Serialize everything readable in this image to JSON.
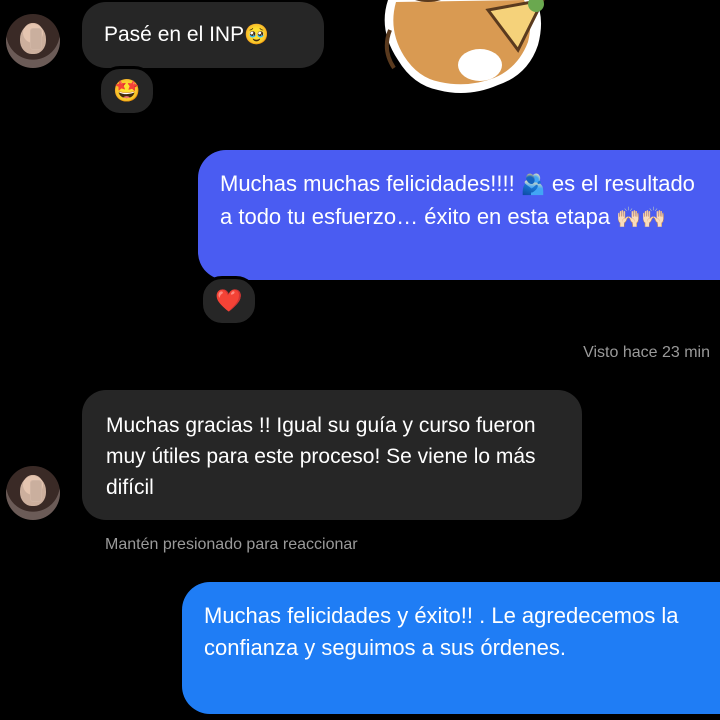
{
  "messages": [
    {
      "text": "Pasé en el INP",
      "emoji": "🥹",
      "reaction": "🤩"
    },
    {
      "text_1": "Muchas muchas felicidades!!!! ",
      "emoji_1": "🫂",
      "text_2": " es el resultado a todo tu esfuerzo… éxito en esta etapa ",
      "emoji_2": "🙌🏻🙌🏻",
      "reaction": "❤️"
    },
    {
      "text": "Muchas gracias !! Igual su guía y curso fueron muy útiles para este proceso! Se viene lo más difícil"
    },
    {
      "text": "Muchas felicidades y éxito!! . Le agredecemos la confianza y seguimos a sus órdenes."
    }
  ],
  "seen_status": "Visto hace 23 min",
  "hold_hint": "Mantén presionado para reaccionar",
  "colors": {
    "incoming": "#262626",
    "outgoing_1": "#4a5cf2",
    "outgoing_2": "#1f7df5",
    "background": "#000000"
  }
}
